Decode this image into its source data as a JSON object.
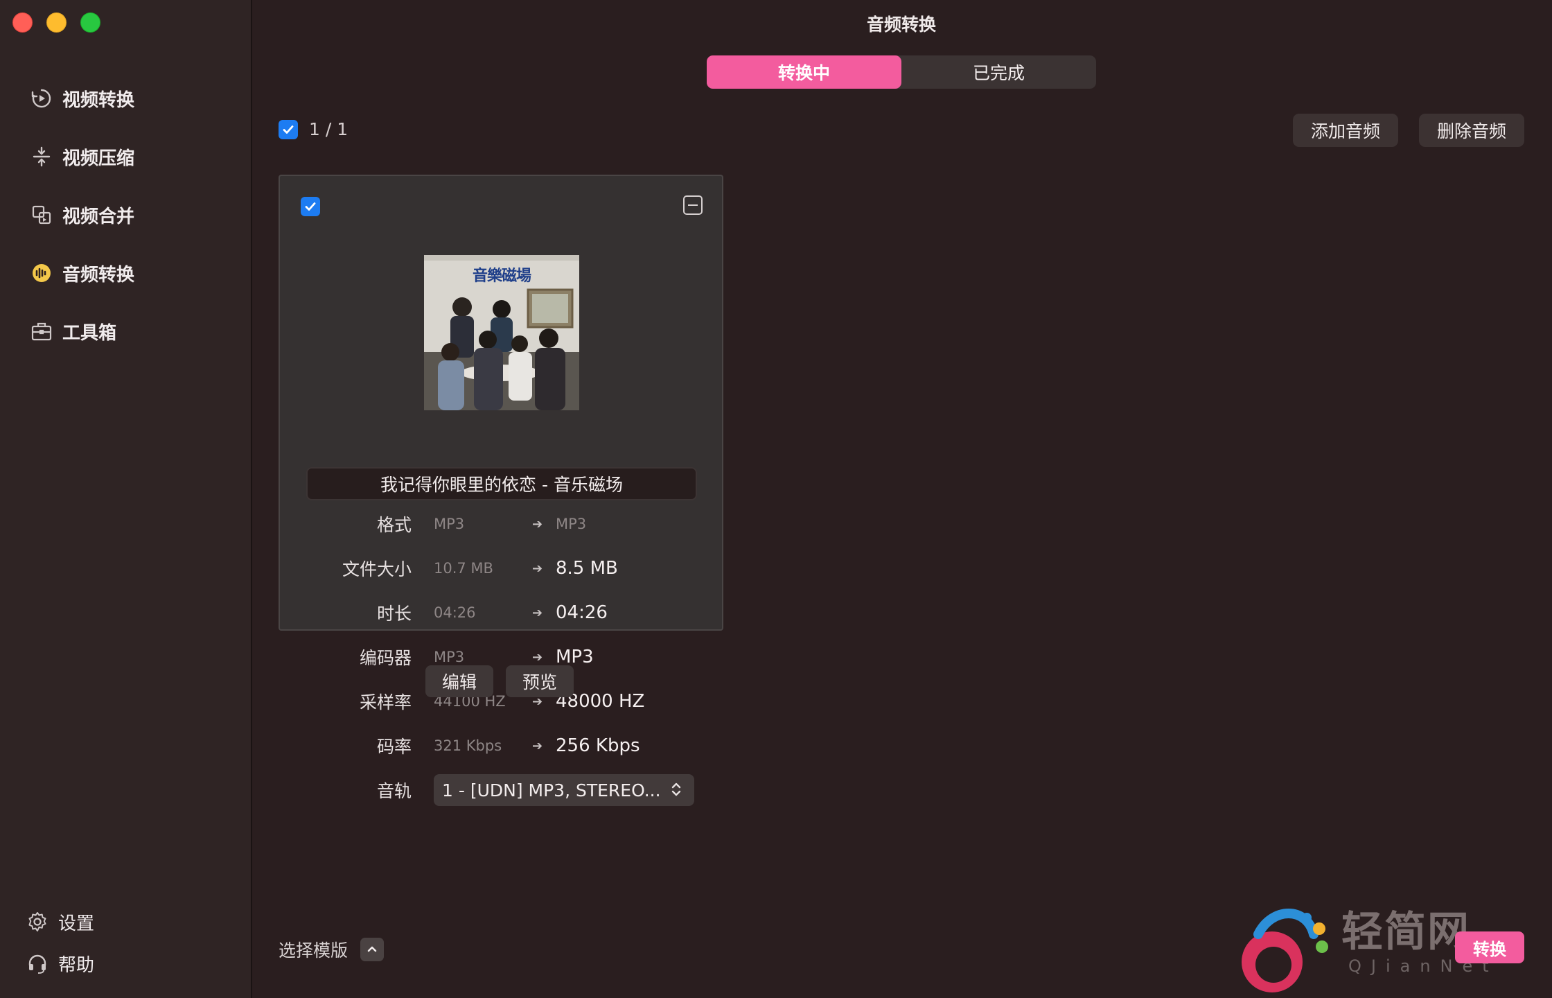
{
  "window": {
    "title": "音频转换"
  },
  "sidebar": {
    "items": [
      {
        "label": "视频转换",
        "icon": "video-convert-icon"
      },
      {
        "label": "视频压缩",
        "icon": "compress-icon"
      },
      {
        "label": "视频合并",
        "icon": "merge-icon"
      },
      {
        "label": "音频转换",
        "icon": "audio-convert-icon",
        "active": true
      },
      {
        "label": "工具箱",
        "icon": "toolbox-icon"
      }
    ],
    "bottom": [
      {
        "label": "设置",
        "icon": "gear-icon"
      },
      {
        "label": "帮助",
        "icon": "headset-icon"
      }
    ]
  },
  "tabs": [
    {
      "label": "转换中",
      "active": true
    },
    {
      "label": "已完成",
      "active": false
    }
  ],
  "toolbar": {
    "select_count": "1 / 1",
    "add_label": "添加音频",
    "delete_label": "删除音频"
  },
  "card": {
    "filename": "我记得你眼里的依恋 - 音乐磁场",
    "cover_text": "音樂磁場",
    "rows": [
      {
        "label": "格式",
        "old": "MP3",
        "new": "MP3"
      },
      {
        "label": "文件大小",
        "old": "10.7 MB",
        "new": "8.5 MB"
      },
      {
        "label": "时长",
        "old": "04:26",
        "new": "04:26"
      },
      {
        "label": "编码器",
        "old": "MP3",
        "new": "MP3"
      },
      {
        "label": "采样率",
        "old": "44100 HZ",
        "new": "48000 HZ"
      },
      {
        "label": "码率",
        "old": "321 Kbps",
        "new": "256 Kbps"
      }
    ],
    "track_label": "音轨",
    "track_value": "1 - [UDN] MP3, STEREO...",
    "edit_label": "编辑",
    "preview_label": "预览"
  },
  "footer": {
    "template_label": "选择模版",
    "convert_label": "转换"
  },
  "watermark": {
    "text": "轻简网",
    "sub": "QJianNet"
  },
  "colors": {
    "accent": "#f35c9e",
    "checkbox": "#1d7cf2",
    "background": "#2a1e1f",
    "sidebar": "#2f2424"
  }
}
